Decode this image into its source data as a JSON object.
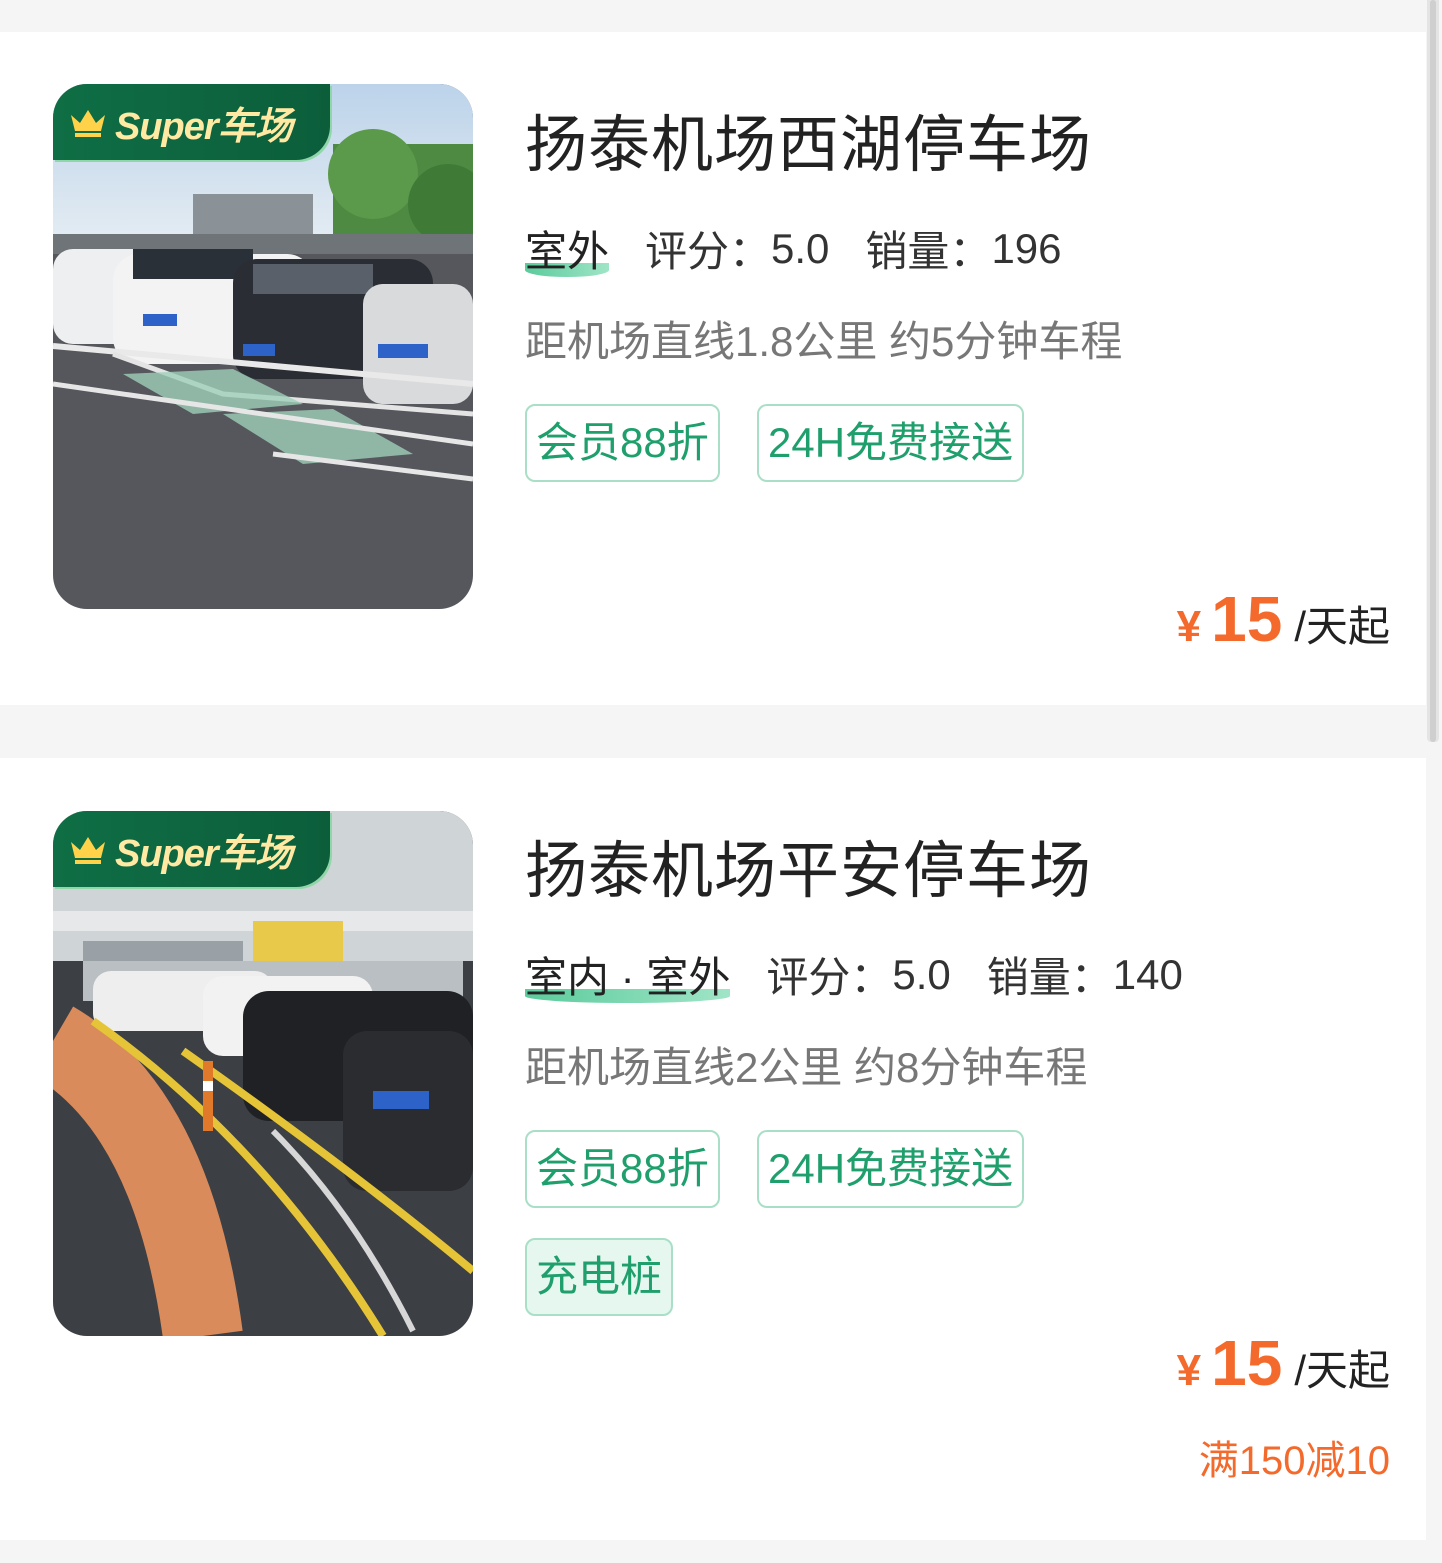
{
  "badge": {
    "text": "Super车场"
  },
  "lots": [
    {
      "name": "扬泰机场西湖停车场",
      "type": "室外",
      "rating_label": "评分：",
      "rating": "5.0",
      "sales_label": "销量：",
      "sales": "196",
      "distance": "距机场直线1.8公里 约5分钟车程",
      "tags": [
        "会员88折",
        "24H免费接送"
      ],
      "currency": "¥",
      "price": "15",
      "price_unit": "/天起"
    },
    {
      "name": "扬泰机场平安停车场",
      "type": "室内 · 室外",
      "rating_label": "评分：",
      "rating": "5.0",
      "sales_label": "销量：",
      "sales": "140",
      "distance": "距机场直线2公里 约8分钟车程",
      "tags": [
        "会员88折",
        "24H免费接送",
        "充电桩"
      ],
      "currency": "¥",
      "price": "15",
      "price_unit": "/天起",
      "promo": "满150减10"
    }
  ],
  "colors": {
    "accent_green": "#1e9f6b",
    "price_orange": "#f36a2c",
    "badge_green": "#0f6e45"
  }
}
